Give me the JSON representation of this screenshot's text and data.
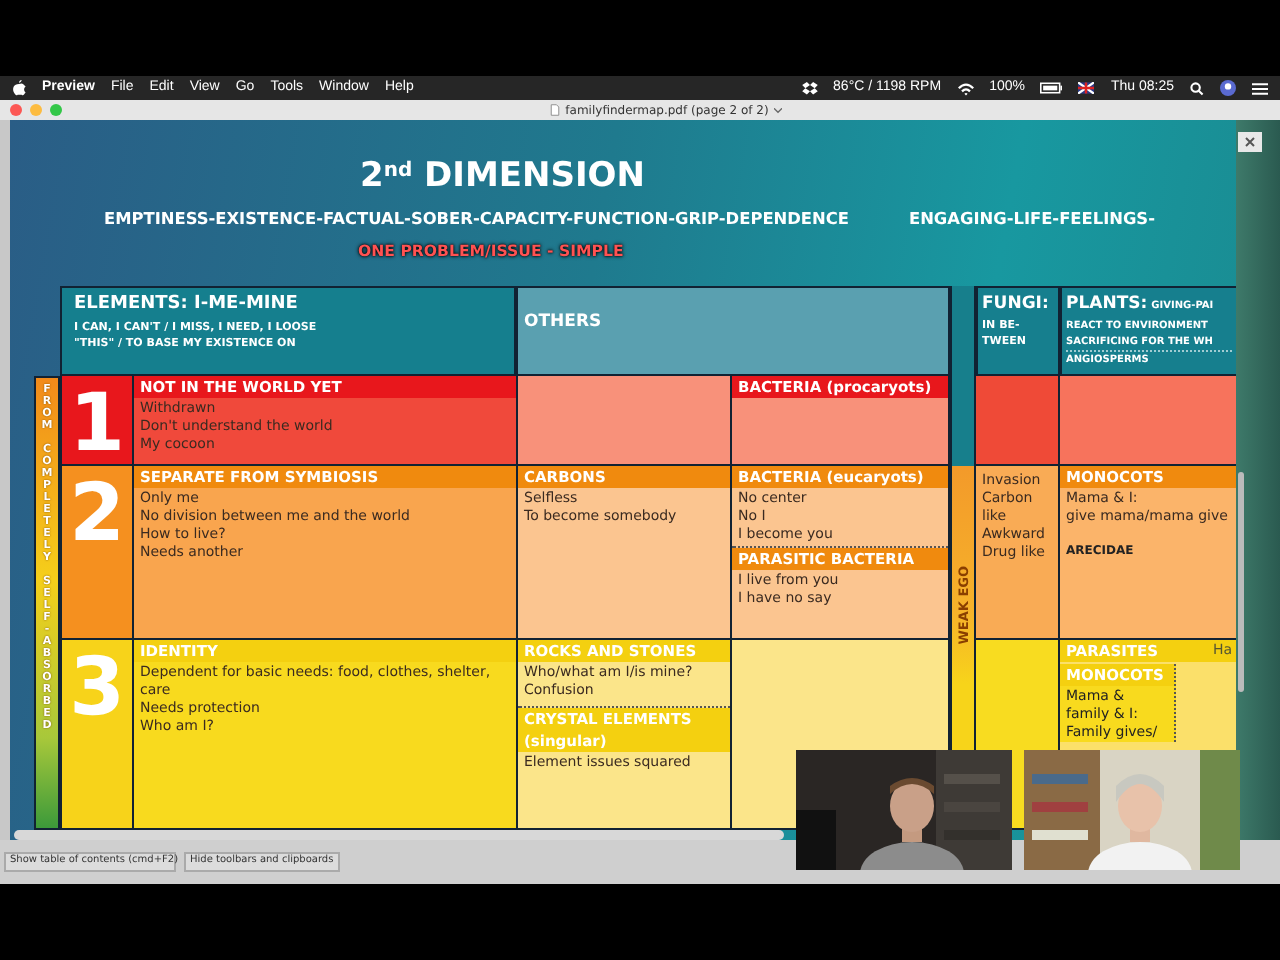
{
  "menubar": {
    "app": "Preview",
    "menus": [
      "File",
      "Edit",
      "View",
      "Go",
      "Tools",
      "Window",
      "Help"
    ],
    "sensors": "86°C / 1198 RPM",
    "battery": "100%",
    "clock": "Thu 08:25"
  },
  "window": {
    "title": "familyfindermap.pdf (page 2 of 2)"
  },
  "document": {
    "title": "2$^{nd}$ DIMENSION",
    "subtitles": [
      "EMPTINESS-EXISTENCE-FACTUAL-SOBER-CAPACITY-FUNCTION-GRIP-DEPENDENCE",
      "ENGAGING-LIFE-FEELINGS-"
    ],
    "tagline": "ONE PROBLEM/ISSUE - SIMPLE",
    "table": {
      "side_label": "FROM COMPLETELY SELF-ABSORBED",
      "weak_label": "WEAK EGO",
      "headers": [
        {
          "title": "ELEMENTS: I-ME-MINE",
          "lines": [
            "I CAN, I CAN'T / I MISS, I NEED, I LOOSE",
            "\"THIS\" / TO BASE MY EXISTENCE ON"
          ]
        },
        {
          "title": "OTHERS"
        },
        {
          "title": "FUNGI:",
          "lines": [
            "IN BE-",
            "TWEEN"
          ]
        },
        {
          "title": "PLANTS:",
          "note": "GIVING-PAI",
          "lines": [
            "REACT TO ENVIRONMENT",
            "SACRIFICING FOR THE WH"
          ],
          "sub": "ANGIOSPERMS"
        }
      ],
      "rows": [
        {
          "number": "1",
          "elements": {
            "heading": "NOT IN THE WORLD YET",
            "lines": [
              "Withdrawn",
              "Don't understand the world",
              "My cocoon"
            ]
          },
          "others_a": [],
          "others_b": [
            {
              "heading": "BACTERIA (procaryots)"
            }
          ],
          "fungi": [],
          "plants": []
        },
        {
          "number": "2",
          "elements": {
            "heading": "SEPARATE FROM SYMBIOSIS",
            "lines": [
              "Only me",
              "No division between me and the world",
              "How to live?",
              "Needs another"
            ]
          },
          "others_a": [
            {
              "heading": "CARBONS",
              "lines": [
                "Selfless",
                "To become somebody"
              ]
            }
          ],
          "others_b": [
            {
              "heading": "BACTERIA (eucaryots)",
              "lines": [
                "No center",
                "No I",
                "I become you"
              ]
            },
            {
              "heading": "PARASITIC BACTERIA",
              "lines": [
                "I live from you",
                "I have no say"
              ]
            }
          ],
          "fungi": [
            "Invasion",
            "Carbon like",
            "Awkward",
            "Drug like"
          ],
          "plants": [
            {
              "kind": "band",
              "heading": "MONOCOTS",
              "lines": [
                "Mama & I:",
                "give mama/mama give"
              ]
            },
            {
              "kind": "subheading",
              "heading": "ARECIDAE"
            }
          ]
        },
        {
          "number": "3",
          "elements": {
            "heading": "IDENTITY",
            "lines": [
              "Dependent for basic needs: food, clothes, shelter, care",
              "Needs protection",
              "Who am I?"
            ]
          },
          "others_a": [
            {
              "heading": "ROCKS AND STONES",
              "lines": [
                "Who/what am I/is mine?",
                "Confusion"
              ]
            },
            {
              "heading": "CRYSTAL ELEMENTS (singular)",
              "lines": [
                "Element issues squared"
              ]
            }
          ],
          "others_b": [],
          "fungi": [],
          "plants": [
            {
              "kind": "band",
              "heading": "PARASITES",
              "note": "Ha"
            },
            {
              "kind": "narrow",
              "heading": "MONOCOTS",
              "lines": [
                "Mama &",
                "family & I:",
                "Family gives/"
              ]
            }
          ]
        }
      ]
    }
  },
  "footer": {
    "buttons": [
      "Show table of contents (cmd+F2)",
      "Hide toolbars and clipboards"
    ]
  }
}
